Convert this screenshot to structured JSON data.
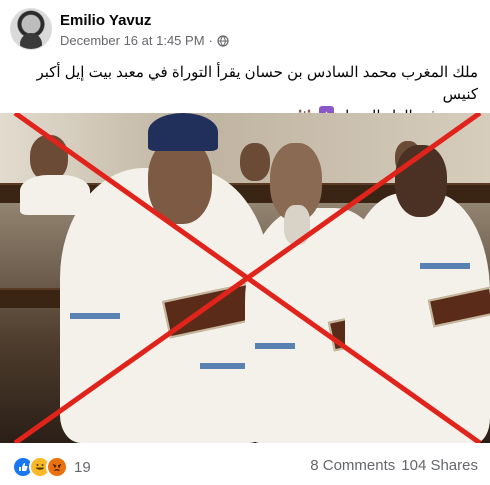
{
  "post": {
    "author": "Emilio Yavuz",
    "date": "December 16 at 1:45 PM",
    "separator": "·",
    "text_line1": "ملك المغرب محمد السادس بن حسان يقرأ التوراة في معبد بيت إيل أكبر كنيس",
    "text_line2": "يهودي في الدار البيضاء",
    "emoji1": "✡",
    "emoji2": "🕍",
    "privacy_icon": "globe-icon",
    "reaction_icons": [
      "like-icon",
      "haha-icon",
      "angry-icon"
    ],
    "reaction_count": "19",
    "comments": "8 Comments",
    "shares": "104 Shares"
  },
  "colors": {
    "false_cross": "#e0241b",
    "like": "#1877f2",
    "haha": "#f7b928",
    "angry": "#e9710f",
    "meta_text": "#65676b"
  }
}
